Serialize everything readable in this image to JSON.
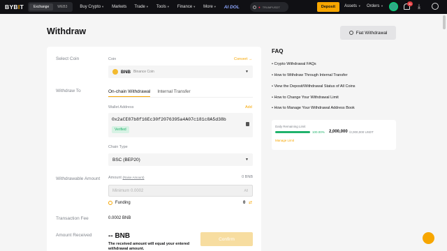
{
  "nav": {
    "logo": "BYB",
    "logo_dot": "I",
    "logo_end": "T",
    "seg": [
      "Exchange",
      "WEB3"
    ],
    "links": [
      "Buy Crypto",
      "Markets",
      "Trade",
      "Tools",
      "Finance",
      "More"
    ],
    "ai": "AI DOL",
    "search_text": "TRUMPUSDT",
    "deposit": "Deposit",
    "assets": "Assets",
    "orders": "Orders",
    "badge": "31"
  },
  "page": {
    "title": "Withdraw",
    "fiat_btn": "Fiat Withdrawal"
  },
  "form": {
    "select_coin": "Select Coin",
    "coin_sub": "Coin",
    "convert": "Convert",
    "coin_sym": "BNB",
    "coin_name": "Binance Coin",
    "withdraw_to": "Withdraw To",
    "tab_onchain": "On-chain Withdrawal",
    "tab_internal": "Internal Transfer",
    "wallet_label": "Wallet Address",
    "add": "Add",
    "address": "0x2aCE87b8f16Ec30f2076395a4A07c181c8A5d38b",
    "verified": "Verified",
    "chain_label": "Chain Type",
    "chain_value": "BSC (BEP20)",
    "withdrawable": "Withdrawable Amount",
    "amount_label": "Amount",
    "raise_amount": "(Raise Amount)",
    "avail_amount": "0 BNB",
    "amount_placeholder": "Minimum 0.0002",
    "all": "All",
    "funding": "Funding",
    "funding_val": "0",
    "fee_label": "Transaction Fee",
    "fee_val": "0.0002 BNB",
    "received_label": "Amount Received",
    "received_val": "-- BNB",
    "received_note": "The received amount will equal your entered withdrawal amount.",
    "confirm": "Confirm"
  },
  "faq": {
    "title": "FAQ",
    "items": [
      "Crypto Withdrawal FAQs",
      "How to Withdraw Through Internal Transfer",
      "View the Deposit/Withdrawal Status of All Coins",
      "How to Change Your Withdrawal Limit",
      "How to Manage Your Withdrawal Address Book"
    ]
  },
  "limit": {
    "label": "Daily Remaining Limit",
    "pct": "100.00%",
    "pct_fraction": 1.0,
    "available": "2,000,000",
    "total": "/2,000,000 USDT",
    "manage": "Manage Limit"
  }
}
